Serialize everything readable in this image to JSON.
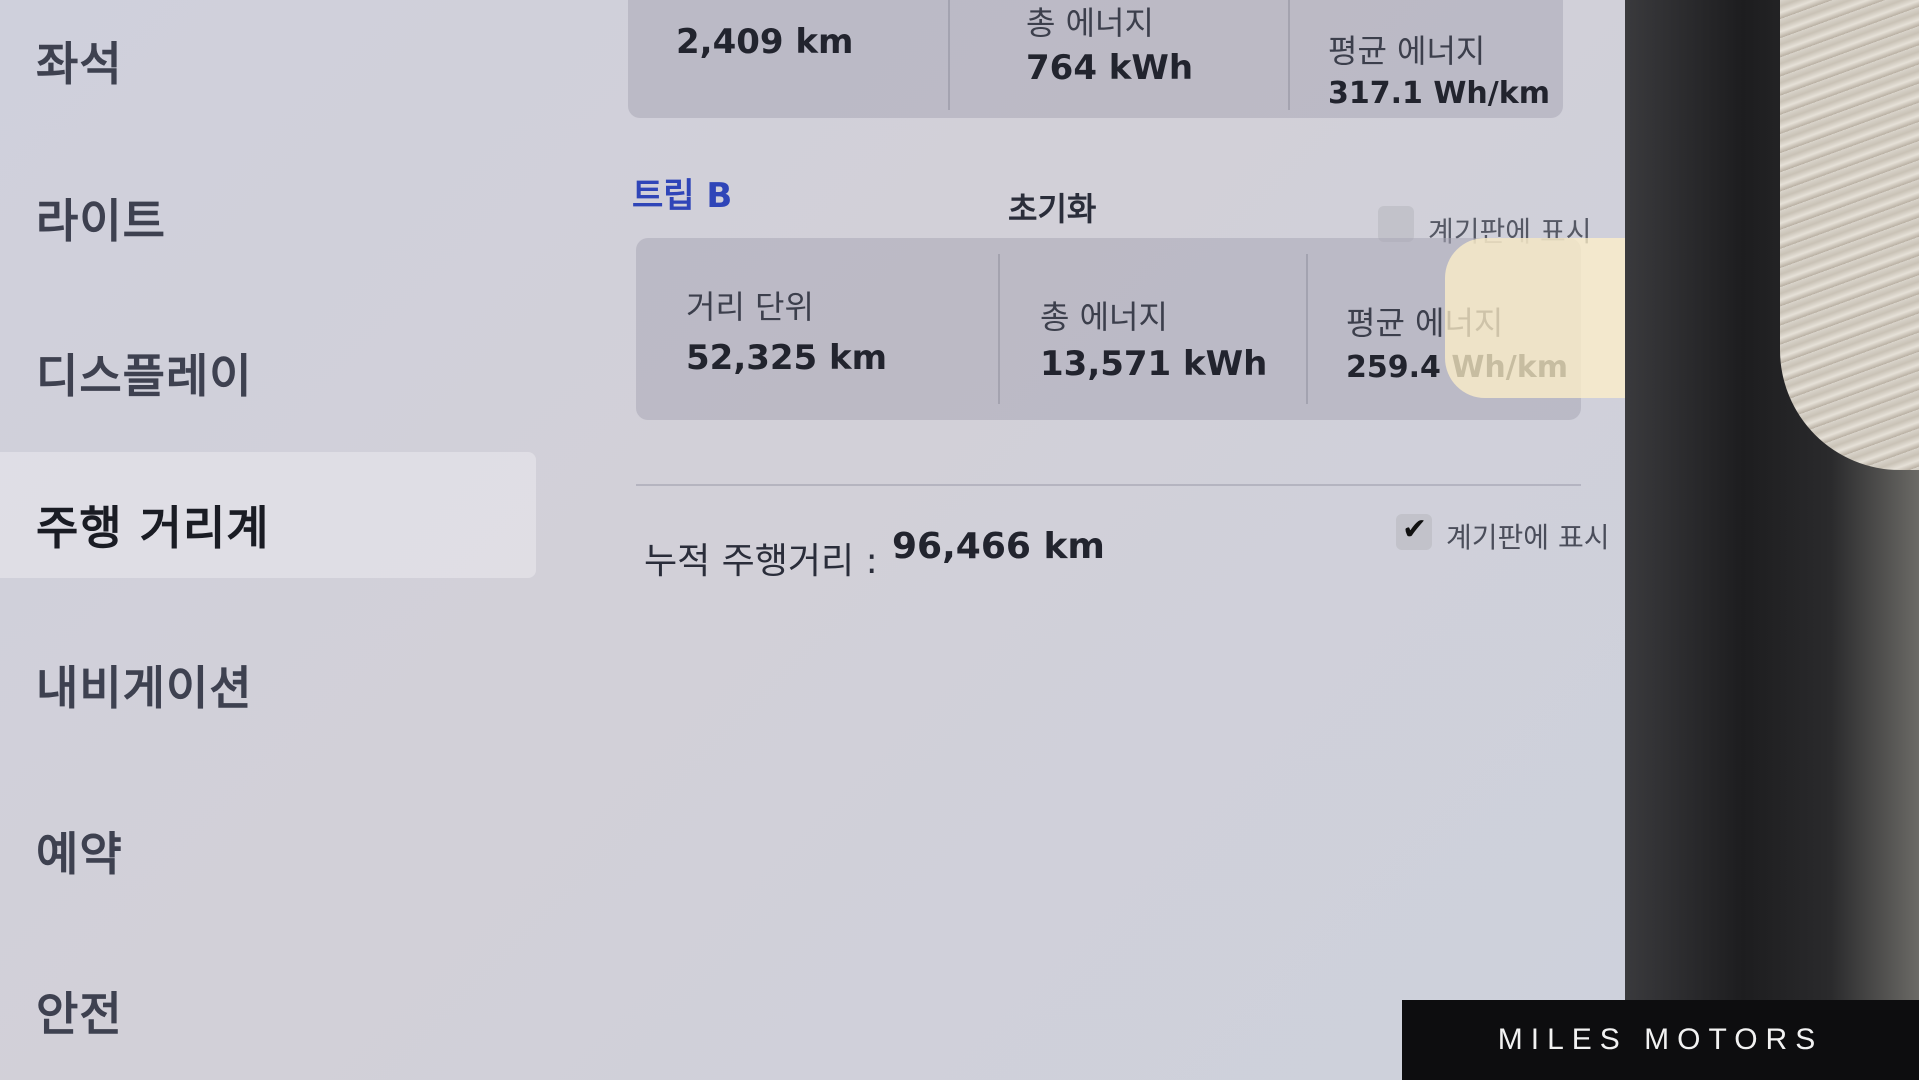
{
  "sidebar": {
    "items": [
      {
        "label": "좌석"
      },
      {
        "label": "라이트"
      },
      {
        "label": "디스플레이"
      },
      {
        "label": "주행 거리계"
      },
      {
        "label": "내비게이션"
      },
      {
        "label": "예약"
      },
      {
        "label": "안전"
      }
    ],
    "active_index": 3
  },
  "trip_a": {
    "distance_value": "2,409 km",
    "energy_label": "총 에너지",
    "energy_value": "764 kWh",
    "avg_label": "평균 에너지",
    "avg_value": "317.1 Wh/km"
  },
  "trip_b": {
    "title": "트립 B",
    "reset_label": "초기화",
    "show_on_cluster_label": "계기판에 표시",
    "show_on_cluster_checked": false,
    "distance_label": "거리 단위",
    "distance_value": "52,325 km",
    "energy_label": "총 에너지",
    "energy_value": "13,571 kWh",
    "avg_label": "평균 에너지",
    "avg_value": "259.4 Wh/km"
  },
  "odometer": {
    "label": "누적 주행거리 :",
    "value": "96,466 km",
    "show_on_cluster_label": "계기판에 표시",
    "show_on_cluster_checked": true,
    "check_glyph": "✔"
  },
  "watermark": {
    "text": "MILES MOTORS"
  },
  "colors": {
    "accent_blue": "#2f45b8",
    "badge_bg": "#0d0d0f"
  }
}
